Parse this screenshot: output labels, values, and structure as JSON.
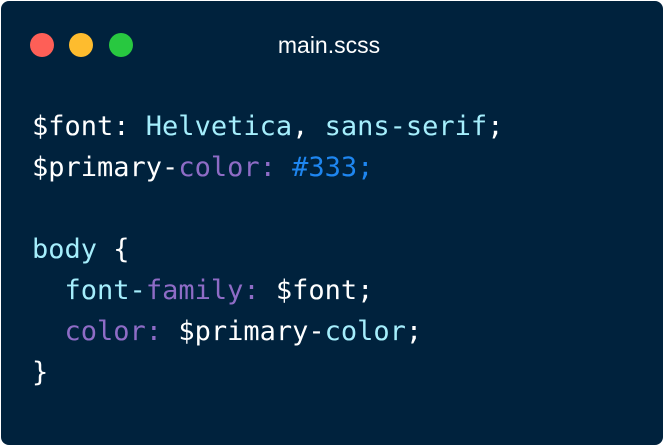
{
  "window": {
    "title": "main.scss",
    "background": "#00223d",
    "controls": [
      {
        "name": "close",
        "color": "#fe5f57"
      },
      {
        "name": "minimize",
        "color": "#febc2e"
      },
      {
        "name": "maximize",
        "color": "#28c840"
      }
    ]
  },
  "code": {
    "language": "scss",
    "colors": {
      "text": "#ffffff",
      "identifier": "#a5eefc",
      "property": "#8e6cc6",
      "value": "#1e86f0"
    },
    "lines": [
      {
        "tokens": [
          "$font",
          ": ",
          "Helvetica",
          ", ",
          "sans-serif",
          ";"
        ]
      },
      {
        "tokens": [
          "$primary",
          "-",
          "color",
          ": ",
          "#333",
          ";"
        ]
      },
      {
        "tokens": []
      },
      {
        "tokens": [
          "body",
          " {"
        ]
      },
      {
        "tokens": [
          "  ",
          "font",
          "-",
          "family",
          ": ",
          "$font",
          ";"
        ]
      },
      {
        "tokens": [
          "  ",
          "color",
          ": ",
          "$primary",
          "-",
          "color",
          ";"
        ]
      },
      {
        "tokens": [
          "}"
        ]
      }
    ]
  }
}
